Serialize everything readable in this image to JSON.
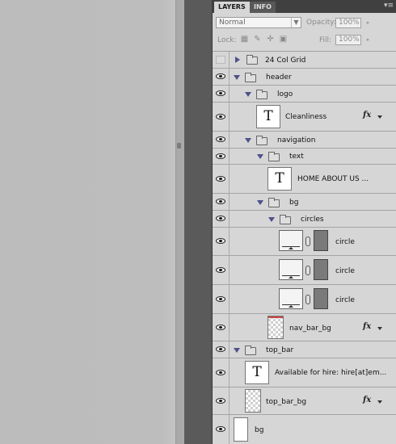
{
  "panel": {
    "tabs": [
      {
        "label": "LAYERS",
        "active": true
      },
      {
        "label": "INFO",
        "active": false
      }
    ],
    "menu_icon": "panel-menu-icon"
  },
  "options": {
    "blend_mode": "Normal",
    "opacity_label": "Opacity:",
    "opacity_value": "100%",
    "lock_label": "Lock:",
    "lock_icons": [
      "lock-transparent-icon",
      "lock-brush-icon",
      "lock-move-icon",
      "lock-all-icon"
    ],
    "fill_label": "Fill:",
    "fill_value": "100%"
  },
  "layers": [
    {
      "name": "24 Col Grid",
      "type": "group",
      "visible": false,
      "expanded": false,
      "indent": 0
    },
    {
      "name": "header",
      "type": "group",
      "visible": true,
      "expanded": true,
      "indent": 0
    },
    {
      "name": "logo",
      "type": "group",
      "visible": true,
      "expanded": true,
      "indent": 1
    },
    {
      "name": "Cleanliness",
      "type": "text",
      "visible": true,
      "fx": true
    },
    {
      "name": "navigation",
      "type": "group",
      "visible": true,
      "expanded": true,
      "indent": 1
    },
    {
      "name": "text",
      "type": "group",
      "visible": true,
      "expanded": true,
      "indent": 2
    },
    {
      "name": "HOME    ABOUT US ...",
      "type": "text",
      "visible": true,
      "fx": false
    },
    {
      "name": "bg",
      "type": "group",
      "visible": true,
      "expanded": true,
      "indent": 2
    },
    {
      "name": "circles",
      "type": "group",
      "visible": true,
      "expanded": true,
      "indent": 3
    },
    {
      "name": "circle",
      "type": "shape",
      "visible": true
    },
    {
      "name": "circle",
      "type": "shape",
      "visible": true
    },
    {
      "name": "circle",
      "type": "shape",
      "visible": true
    },
    {
      "name": "nav_bar_bg",
      "type": "raster",
      "visible": true,
      "fx": true
    },
    {
      "name": "top_bar",
      "type": "group",
      "visible": true,
      "expanded": true,
      "indent": 0
    },
    {
      "name": "Available for hire: hire[at]em...",
      "type": "text",
      "visible": true,
      "fx": false
    },
    {
      "name": "top_bar_bg",
      "type": "raster",
      "visible": true,
      "fx": true
    },
    {
      "name": "bg",
      "type": "raster",
      "visible": true,
      "fx": false
    }
  ],
  "fx_label": "fx",
  "colors": {
    "panel_bg": "#d6d6d6",
    "tab_bar": "#404040",
    "triangle": "#50508a",
    "canvas": "#bcbcbc"
  }
}
